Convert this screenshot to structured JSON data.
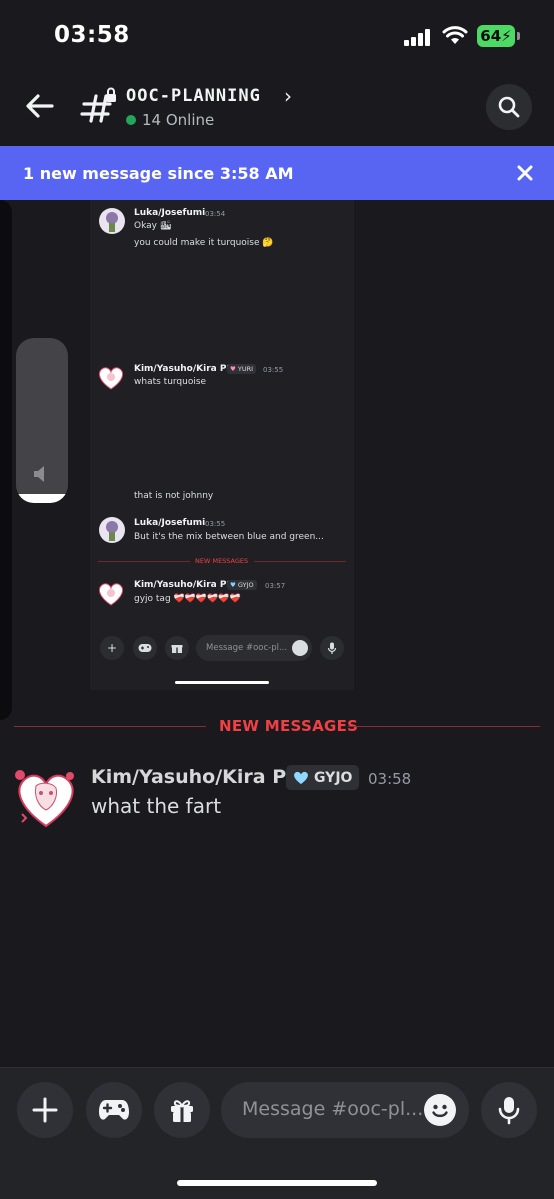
{
  "status_bar": {
    "time": "03:58",
    "battery": "64"
  },
  "header": {
    "channel_name": "OOC-PLANNING",
    "online_count": "14 Online"
  },
  "banner": {
    "text": "1 new message since 3:58 AM"
  },
  "embedded_screenshot": {
    "messages": [
      {
        "author": "Luka/Josefumi",
        "time": "03:54",
        "lines": [
          "Okay 🏙",
          "you could make it turquoise 🤔"
        ]
      },
      {
        "author": "Kim/Yasuho/Kira P8",
        "badge": "YURI",
        "time": "03:55",
        "lines": [
          "whats turquoise"
        ]
      },
      {
        "author": "",
        "lines": [
          "that is not johnny"
        ]
      },
      {
        "author": "Luka/Josefumi",
        "time": "03:55",
        "lines": [
          "But it's the mix between blue and green..."
        ]
      },
      {
        "author": "Kim/Yasuho/Kira P8",
        "badge": "GYJO",
        "time": "03:57",
        "lines": [
          "gyjo tag ❤️‍🩹❤️‍🩹❤️‍🩹❤️‍🩹❤️‍🩹❤️‍🩹"
        ]
      }
    ],
    "divider": "NEW MESSAGES",
    "input_placeholder": "Message #ooc-pl..."
  },
  "divider": {
    "label": "NEW MESSAGES"
  },
  "message": {
    "author": "Kim/Yasuho/Kira P8",
    "badge": "GYJO",
    "time": "03:58",
    "text": "what the fart"
  },
  "composer": {
    "placeholder": "Message #ooc-pl..."
  },
  "colors": {
    "accent": "#5865f2",
    "new_messages": "#f23f43",
    "online": "#23a55a",
    "background": "#1a1a1e"
  },
  "icons": [
    "back-arrow-icon",
    "hash-lock-icon",
    "chevron-right-icon",
    "search-icon",
    "close-icon",
    "plus-icon",
    "gamepad-icon",
    "gift-icon",
    "emoji-icon",
    "microphone-icon",
    "volume-icon"
  ]
}
